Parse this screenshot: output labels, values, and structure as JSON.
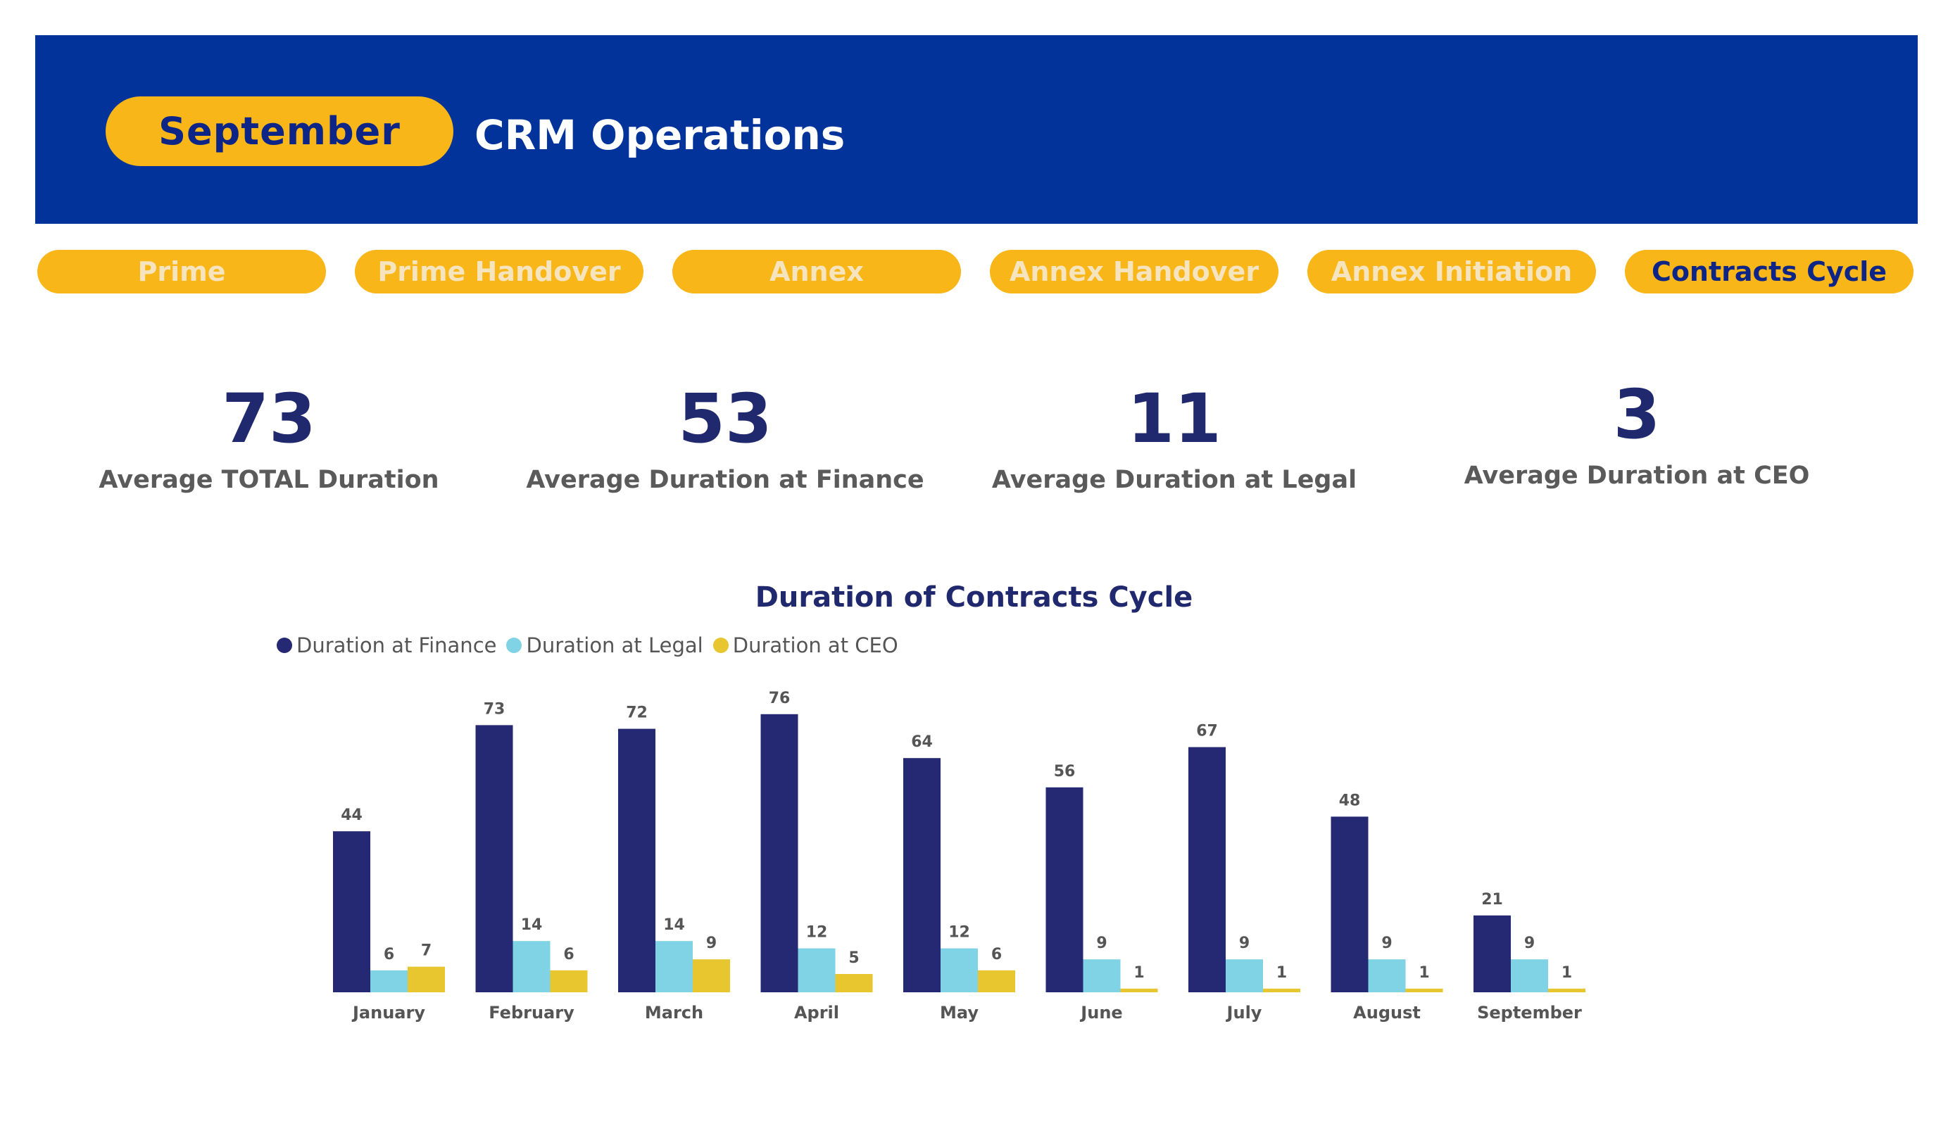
{
  "header": {
    "month": "September",
    "title": "CRM Operations"
  },
  "nav": {
    "tabs": [
      {
        "label": "Prime",
        "active": false
      },
      {
        "label": "Prime Handover",
        "active": false
      },
      {
        "label": "Annex",
        "active": false
      },
      {
        "label": "Annex Handover",
        "active": false
      },
      {
        "label": "Annex Initiation",
        "active": false
      },
      {
        "label": "Contracts Cycle",
        "active": true
      }
    ]
  },
  "kpis": [
    {
      "value": "73",
      "label": "Average TOTAL Duration"
    },
    {
      "value": "53",
      "label": "Average Duration at Finance"
    },
    {
      "value": "11",
      "label": "Average Duration at Legal"
    },
    {
      "value": "3",
      "label": "Average Duration at CEO"
    }
  ],
  "colors": {
    "banner": "#02339a",
    "accent": "#f8b618",
    "finance": "#252872",
    "legal": "#7fd3e5",
    "ceo": "#e8c630"
  },
  "chart_data": {
    "type": "bar",
    "title": "Duration of Contracts Cycle",
    "xlabel": "",
    "ylabel": "",
    "ylim": [
      0,
      80
    ],
    "grid": false,
    "legend_position": "top-left",
    "categories": [
      "January",
      "February",
      "March",
      "April",
      "May",
      "June",
      "July",
      "August",
      "September"
    ],
    "series": [
      {
        "name": "Duration at Finance",
        "color": "#252872",
        "values": [
          44,
          73,
          72,
          76,
          64,
          56,
          67,
          48,
          21
        ]
      },
      {
        "name": "Duration at Legal",
        "color": "#7fd3e5",
        "values": [
          6,
          14,
          14,
          12,
          12,
          9,
          9,
          9,
          9
        ]
      },
      {
        "name": "Duration at CEO",
        "color": "#e8c630",
        "values": [
          7,
          6,
          9,
          5,
          6,
          1,
          1,
          1,
          1
        ]
      }
    ]
  }
}
